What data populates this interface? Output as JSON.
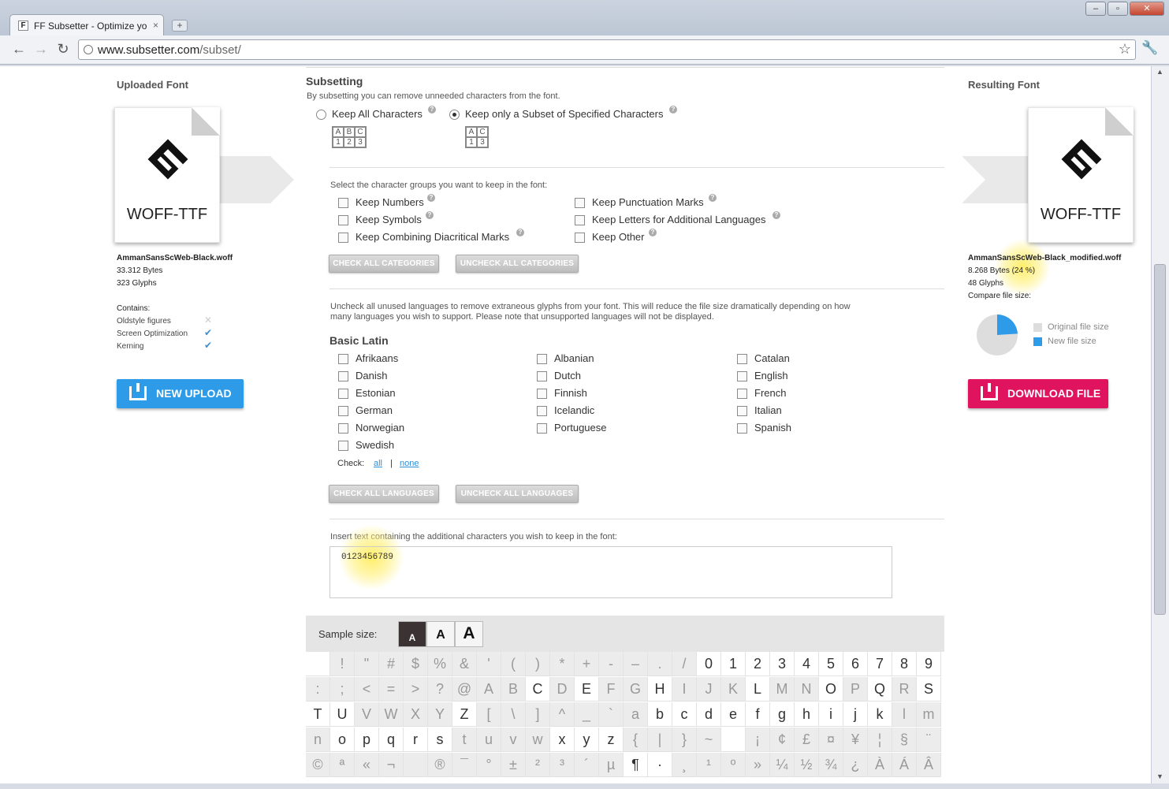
{
  "browser": {
    "tab_title": "FF Subsetter - Optimize yo",
    "tab_close": "×",
    "new_tab": "+",
    "url_host": "www.subsetter.com",
    "url_path": "/subset/",
    "win_min": "–",
    "win_max": "▫",
    "win_close": "✕"
  },
  "uploaded": {
    "heading": "Uploaded Font",
    "format": "WOFF-TTF",
    "filename": "AmmanSansScWeb-Black.woff",
    "bytes": "33.312 Bytes",
    "glyphs": "323 Glyphs",
    "contains_label": "Contains:",
    "features": [
      {
        "name": "Oldstyle figures",
        "enabled": false
      },
      {
        "name": "Screen Optimization",
        "enabled": true
      },
      {
        "name": "Kerning",
        "enabled": true
      }
    ],
    "button": "NEW UPLOAD"
  },
  "result": {
    "heading": "Resulting Font",
    "format": "WOFF-TTF",
    "filename": "AmmanSansScWeb-Black_modified.woff",
    "bytes": "8.268 Bytes (24 %)",
    "glyphs": "48 Glyphs",
    "compare_label": "Compare file size:",
    "new_ratio": 0.24,
    "legend_original": "Original file size",
    "legend_new": "New file size",
    "color_original": "#dddddd",
    "color_new": "#2d9be8",
    "button": "DOWNLOAD FILE"
  },
  "subsetting": {
    "title": "Subsetting",
    "description": "By subsetting you can remove unneeded characters from the font.",
    "mode_all": "Keep All Characters",
    "mode_subset": "Keep only a Subset of Specified Characters",
    "grid_all": [
      "A",
      "B",
      "C",
      "1",
      "2",
      "3"
    ],
    "grid_subset": [
      "A",
      "C",
      "",
      "1",
      "3",
      ""
    ],
    "groups_intro": "Select the character groups you want to keep in the font:",
    "groups": [
      "Keep Numbers",
      "Keep Punctuation Marks",
      "Keep Symbols",
      "Keep Letters for Additional Languages",
      "Keep Combining Diacritical Marks",
      "Keep Other"
    ],
    "check_all_categories": "CHECK ALL CATEGORIES",
    "uncheck_all_categories": "UNCHECK ALL CATEGORIES",
    "languages_intro_1": "Uncheck all unused languages to remove extraneous glyphs from your font. This will reduce the file size dramatically depending on how",
    "languages_intro_2": "many languages you wish to support. Please note that unsupported languages will not be displayed.",
    "basic_latin_title": "Basic Latin",
    "languages": [
      "Afrikaans",
      "Albanian",
      "Catalan",
      "Danish",
      "Dutch",
      "English",
      "Estonian",
      "Finnish",
      "French",
      "German",
      "Icelandic",
      "Italian",
      "Norwegian",
      "Portuguese",
      "Spanish",
      "Swedish"
    ],
    "check_label": "Check:",
    "check_all": "all",
    "check_sep": "|",
    "check_none": "none",
    "check_all_languages": "CHECK ALL LANGUAGES",
    "uncheck_all_languages": "UNCHECK ALL LANGUAGES",
    "insert_label": "Insert text containing the additional characters you wish to keep in the font:",
    "insert_value": "0123456789",
    "sample_size_label": "Sample size:",
    "sample_sizes": [
      "A",
      "A",
      "A"
    ]
  },
  "glyph_rows": [
    [
      [
        "",
        1
      ],
      [
        "!",
        0
      ],
      [
        "\"",
        0
      ],
      [
        "#",
        0
      ],
      [
        "$",
        0
      ],
      [
        "%",
        0
      ],
      [
        "&",
        0
      ],
      [
        "'",
        0
      ],
      [
        "(",
        0
      ],
      [
        ")",
        0
      ],
      [
        "*",
        0
      ],
      [
        "+",
        0
      ],
      [
        "-",
        0
      ],
      [
        "–",
        0
      ],
      [
        ".",
        0
      ],
      [
        "/",
        0
      ],
      [
        "0",
        1
      ],
      [
        "1",
        1
      ],
      [
        "2",
        1
      ],
      [
        "3",
        1
      ],
      [
        "4",
        1
      ],
      [
        "5",
        1
      ],
      [
        "6",
        1
      ],
      [
        "7",
        1
      ],
      [
        "8",
        1
      ],
      [
        "9",
        1
      ]
    ],
    [
      [
        ":",
        0
      ],
      [
        ";",
        0
      ],
      [
        "<",
        0
      ],
      [
        "=",
        0
      ],
      [
        ">",
        0
      ],
      [
        "?",
        0
      ],
      [
        "@",
        0
      ],
      [
        "A",
        0
      ],
      [
        "B",
        0
      ],
      [
        "C",
        1
      ],
      [
        "D",
        0
      ],
      [
        "E",
        1
      ],
      [
        "F",
        0
      ],
      [
        "G",
        0
      ],
      [
        "H",
        1
      ],
      [
        "I",
        0
      ],
      [
        "J",
        0
      ],
      [
        "K",
        0
      ],
      [
        "L",
        1
      ],
      [
        "M",
        0
      ],
      [
        "N",
        0
      ],
      [
        "O",
        1
      ],
      [
        "P",
        0
      ],
      [
        "Q",
        1
      ],
      [
        "R",
        0
      ],
      [
        "S",
        1
      ]
    ],
    [
      [
        "T",
        1
      ],
      [
        "U",
        1
      ],
      [
        "V",
        0
      ],
      [
        "W",
        0
      ],
      [
        "X",
        0
      ],
      [
        "Y",
        0
      ],
      [
        "Z",
        1
      ],
      [
        "[",
        0
      ],
      [
        "\\",
        0
      ],
      [
        "]",
        0
      ],
      [
        "^",
        0
      ],
      [
        "_",
        0
      ],
      [
        "`",
        0
      ],
      [
        "a",
        0
      ],
      [
        "b",
        1
      ],
      [
        "c",
        1
      ],
      [
        "d",
        1
      ],
      [
        "e",
        1
      ],
      [
        "f",
        1
      ],
      [
        "g",
        1
      ],
      [
        "h",
        1
      ],
      [
        "i",
        1
      ],
      [
        "j",
        1
      ],
      [
        "k",
        1
      ],
      [
        "l",
        0
      ],
      [
        "m",
        0
      ]
    ],
    [
      [
        "n",
        0
      ],
      [
        "o",
        1
      ],
      [
        "p",
        1
      ],
      [
        "q",
        1
      ],
      [
        "r",
        1
      ],
      [
        "s",
        1
      ],
      [
        "t",
        0
      ],
      [
        "u",
        0
      ],
      [
        "v",
        0
      ],
      [
        "w",
        0
      ],
      [
        "x",
        1
      ],
      [
        "y",
        1
      ],
      [
        "z",
        1
      ],
      [
        "{",
        0
      ],
      [
        "|",
        0
      ],
      [
        "}",
        0
      ],
      [
        "~",
        0
      ],
      [
        "",
        1
      ],
      [
        "¡",
        0
      ],
      [
        "¢",
        0
      ],
      [
        "£",
        0
      ],
      [
        "¤",
        0
      ],
      [
        "¥",
        0
      ],
      [
        "¦",
        0
      ],
      [
        "§",
        0
      ],
      [
        "¨",
        0
      ]
    ],
    [
      [
        "©",
        0
      ],
      [
        "ª",
        0
      ],
      [
        "«",
        0
      ],
      [
        "¬",
        0
      ],
      [
        "",
        0
      ],
      [
        "®",
        0
      ],
      [
        "¯",
        0
      ],
      [
        "°",
        0
      ],
      [
        "±",
        0
      ],
      [
        "²",
        0
      ],
      [
        "³",
        0
      ],
      [
        "´",
        0
      ],
      [
        "µ",
        0
      ],
      [
        "¶",
        1
      ],
      [
        "·",
        1
      ],
      [
        "¸",
        0
      ],
      [
        "¹",
        0
      ],
      [
        "º",
        0
      ],
      [
        "»",
        0
      ],
      [
        "¼",
        0
      ],
      [
        "½",
        0
      ],
      [
        "¾",
        0
      ],
      [
        "¿",
        0
      ],
      [
        "À",
        0
      ],
      [
        "Á",
        0
      ],
      [
        "Â",
        0
      ]
    ]
  ]
}
